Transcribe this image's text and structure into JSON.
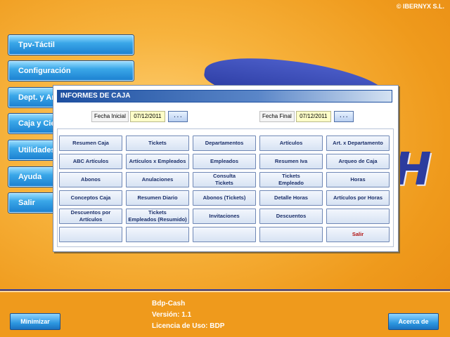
{
  "copyright": "© IBERNYX S.L.",
  "logo_letter": "H",
  "sidebar": {
    "items": [
      {
        "label": "Tpv-Táctil"
      },
      {
        "label": "Configuración"
      },
      {
        "label": "Dept. y Ar"
      },
      {
        "label": "Caja y Cie"
      },
      {
        "label": "Utilidades"
      },
      {
        "label": "Ayuda"
      },
      {
        "label": "Salir"
      }
    ]
  },
  "dialog": {
    "title": "INFORMES DE CAJA",
    "fecha_inicial_label": "Fecha Inicial",
    "fecha_inicial_value": "07/12/2011",
    "fecha_final_label": "Fecha Final",
    "fecha_final_value": "07/12/2011",
    "picker_label": ". . .",
    "buttons": [
      "Resumen Caja",
      "Tickets",
      "Departamentos",
      "Artículos",
      "Art. x Departamento",
      "ABC Artículos",
      "Artículos x Empleados",
      "Empleados",
      "Resumen Iva",
      "Arqueo de Caja",
      "Abonos",
      "Anulaciones",
      "Consulta\nTickets",
      "Tickets\nEmpleado",
      "Horas",
      "Conceptos Caja",
      "Resumen Diario",
      "Abonos (Tickets)",
      "Detalle Horas",
      "Artículos por Horas",
      "Descuentos por\nArtículos",
      "Tickets\nEmpleados (Resumido)",
      "Invitaciones",
      "Descuentos",
      "",
      "",
      "",
      "",
      "",
      "Salir"
    ]
  },
  "footer": {
    "minimize_label": "Minimizar",
    "about_label": "Acerca de",
    "app_name": "Bdp-Cash",
    "version": "Versión: 1.1",
    "license": "Licencia de Uso: BDP"
  },
  "colors": {
    "background": "#ef9a1c",
    "accent": "#2d3ca0",
    "menu_button": "#2a93df",
    "exit_text": "#b01010"
  }
}
